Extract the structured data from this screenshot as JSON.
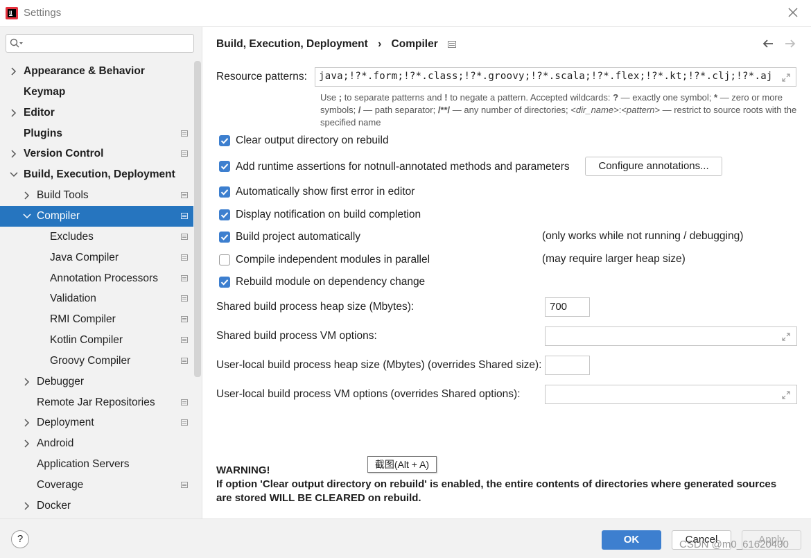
{
  "window": {
    "title": "Settings"
  },
  "search": {
    "placeholder": ""
  },
  "sidebar": {
    "items": [
      {
        "label": "Appearance & Behavior",
        "level": 0,
        "expandable": true,
        "expanded": false,
        "bold": true,
        "project_icon": false,
        "selected": false
      },
      {
        "label": "Keymap",
        "level": 0,
        "expandable": false,
        "expanded": false,
        "bold": true,
        "project_icon": false,
        "selected": false
      },
      {
        "label": "Editor",
        "level": 0,
        "expandable": true,
        "expanded": false,
        "bold": true,
        "project_icon": false,
        "selected": false
      },
      {
        "label": "Plugins",
        "level": 0,
        "expandable": false,
        "expanded": false,
        "bold": true,
        "project_icon": true,
        "selected": false
      },
      {
        "label": "Version Control",
        "level": 0,
        "expandable": true,
        "expanded": false,
        "bold": true,
        "project_icon": true,
        "selected": false
      },
      {
        "label": "Build, Execution, Deployment",
        "level": 0,
        "expandable": true,
        "expanded": true,
        "bold": true,
        "project_icon": false,
        "selected": false
      },
      {
        "label": "Build Tools",
        "level": 1,
        "expandable": true,
        "expanded": false,
        "bold": false,
        "project_icon": true,
        "selected": false
      },
      {
        "label": "Compiler",
        "level": 1,
        "expandable": true,
        "expanded": true,
        "bold": false,
        "project_icon": true,
        "selected": true
      },
      {
        "label": "Excludes",
        "level": 2,
        "expandable": false,
        "expanded": false,
        "bold": false,
        "project_icon": true,
        "selected": false
      },
      {
        "label": "Java Compiler",
        "level": 2,
        "expandable": false,
        "expanded": false,
        "bold": false,
        "project_icon": true,
        "selected": false
      },
      {
        "label": "Annotation Processors",
        "level": 2,
        "expandable": false,
        "expanded": false,
        "bold": false,
        "project_icon": true,
        "selected": false
      },
      {
        "label": "Validation",
        "level": 2,
        "expandable": false,
        "expanded": false,
        "bold": false,
        "project_icon": true,
        "selected": false
      },
      {
        "label": "RMI Compiler",
        "level": 2,
        "expandable": false,
        "expanded": false,
        "bold": false,
        "project_icon": true,
        "selected": false
      },
      {
        "label": "Kotlin Compiler",
        "level": 2,
        "expandable": false,
        "expanded": false,
        "bold": false,
        "project_icon": true,
        "selected": false
      },
      {
        "label": "Groovy Compiler",
        "level": 2,
        "expandable": false,
        "expanded": false,
        "bold": false,
        "project_icon": true,
        "selected": false
      },
      {
        "label": "Debugger",
        "level": 1,
        "expandable": true,
        "expanded": false,
        "bold": false,
        "project_icon": false,
        "selected": false
      },
      {
        "label": "Remote Jar Repositories",
        "level": 1,
        "expandable": false,
        "expanded": false,
        "bold": false,
        "project_icon": true,
        "selected": false
      },
      {
        "label": "Deployment",
        "level": 1,
        "expandable": true,
        "expanded": false,
        "bold": false,
        "project_icon": true,
        "selected": false
      },
      {
        "label": "Android",
        "level": 1,
        "expandable": true,
        "expanded": false,
        "bold": false,
        "project_icon": false,
        "selected": false
      },
      {
        "label": "Application Servers",
        "level": 1,
        "expandable": false,
        "expanded": false,
        "bold": false,
        "project_icon": false,
        "selected": false
      },
      {
        "label": "Coverage",
        "level": 1,
        "expandable": false,
        "expanded": false,
        "bold": false,
        "project_icon": true,
        "selected": false
      },
      {
        "label": "Docker",
        "level": 1,
        "expandable": true,
        "expanded": false,
        "bold": false,
        "project_icon": false,
        "selected": false
      }
    ]
  },
  "breadcrumb": {
    "parent": "Build, Execution, Deployment",
    "separator": "›",
    "current": "Compiler"
  },
  "resource": {
    "label": "Resource patterns:",
    "value": "java;!?*.form;!?*.class;!?*.groovy;!?*.scala;!?*.flex;!?*.kt;!?*.clj;!?*.aj",
    "hint": {
      "p1": "Use ",
      "b1": ";",
      "p2": " to separate patterns and ",
      "b2": "!",
      "p3": " to negate a pattern. Accepted wildcards: ",
      "b3": "?",
      "p4": " — exactly one symbol; ",
      "b4": "*",
      "p5": " — zero or more symbols; ",
      "b5": "/",
      "p6": " — path separator; ",
      "b6": "/**/",
      "p7": " — any number of directories; ",
      "i1": "<dir_name>",
      "p8": ":",
      "i2": "<pattern>",
      "p9": " — restrict to source roots with the specified name"
    }
  },
  "options": {
    "clear_output": {
      "label": "Clear output directory on rebuild",
      "checked": true
    },
    "runtime_assertions": {
      "label": "Add runtime assertions for notnull-annotated methods and parameters",
      "checked": true
    },
    "configure_annotations": "Configure annotations...",
    "show_first_error": {
      "label": "Automatically show first error in editor",
      "checked": true
    },
    "notification": {
      "label": "Display notification on build completion",
      "checked": true
    },
    "build_auto": {
      "label": "Build project automatically",
      "checked": true,
      "note": "(only works while not running / debugging)"
    },
    "parallel": {
      "label": "Compile independent modules in parallel",
      "checked": false,
      "note": "(may require larger heap size)"
    },
    "rebuild_dep": {
      "label": "Rebuild module on dependency change",
      "checked": true
    }
  },
  "fields": {
    "shared_heap": {
      "label": "Shared build process heap size (Mbytes):",
      "value": "700"
    },
    "shared_vm": {
      "label": "Shared build process VM options:",
      "value": ""
    },
    "user_heap": {
      "label": "User-local build process heap size (Mbytes) (overrides Shared size):",
      "value": ""
    },
    "user_vm": {
      "label": "User-local build process VM options (overrides Shared options):",
      "value": ""
    }
  },
  "warning": {
    "title": "WARNING!",
    "text": "If option 'Clear output directory on rebuild' is enabled, the entire contents of directories where generated sources are stored WILL BE CLEARED on rebuild."
  },
  "tooltip": "截图(Alt + A)",
  "footer": {
    "help": "?",
    "ok": "OK",
    "cancel": "Cancel",
    "apply": "Apply"
  },
  "watermark": "CSDN @m0_61620400",
  "colors": {
    "accent": "#3d7fcf",
    "selection": "#2675bf",
    "sidebar_bg": "#f2f2f2"
  }
}
